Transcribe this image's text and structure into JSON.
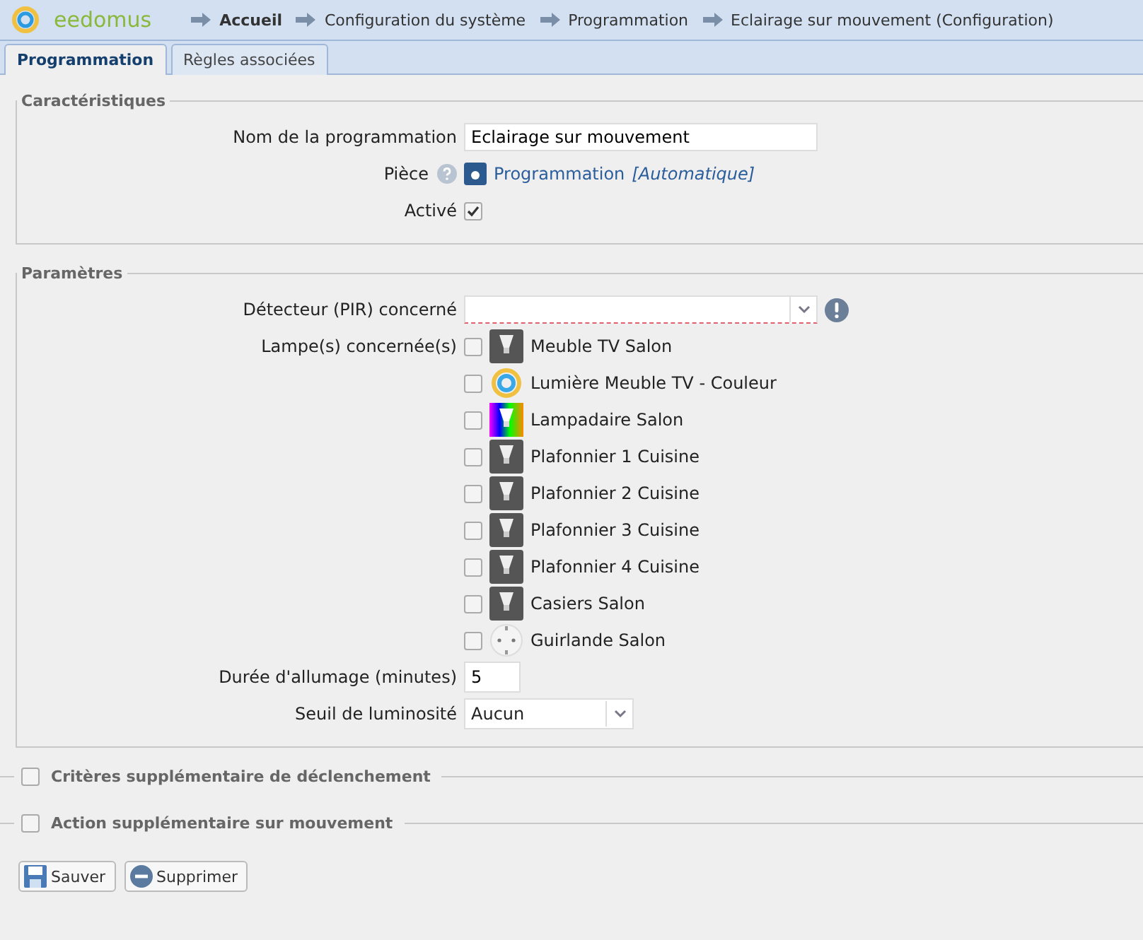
{
  "header": {
    "logo": "eedomus",
    "breadcrumbs": [
      "Accueil",
      "Configuration du système",
      "Programmation",
      "Eclairage sur mouvement (Configuration)"
    ]
  },
  "tabs": [
    {
      "label": "Programmation",
      "selected": true
    },
    {
      "label": "Règles associées",
      "selected": false
    }
  ],
  "caracteristiques": {
    "legend": "Caractéristiques",
    "name_label": "Nom de la programmation",
    "name_value": "Eclairage sur mouvement",
    "room_label": "Pièce",
    "room_value": "Programmation",
    "room_note": "[Automatique]",
    "active_label": "Activé",
    "active_checked": true
  },
  "parametres": {
    "legend": "Paramètres",
    "detector_label": "Détecteur (PIR) concerné",
    "lamps_label": "Lampe(s) concernée(s)",
    "lamps": [
      {
        "name": "Meuble TV Salon",
        "kind": "bulb",
        "checked": false
      },
      {
        "name": "Lumière Meuble TV - Couleur",
        "kind": "ring",
        "checked": false
      },
      {
        "name": "Lampadaire Salon",
        "kind": "color",
        "checked": false
      },
      {
        "name": "Plafonnier 1 Cuisine",
        "kind": "bulb",
        "checked": false
      },
      {
        "name": "Plafonnier 2 Cuisine",
        "kind": "bulb",
        "checked": false
      },
      {
        "name": "Plafonnier 3 Cuisine",
        "kind": "bulb",
        "checked": false
      },
      {
        "name": "Plafonnier 4 Cuisine",
        "kind": "bulb",
        "checked": false
      },
      {
        "name": "Casiers Salon",
        "kind": "bulb",
        "checked": false
      },
      {
        "name": "Guirlande Salon",
        "kind": "plug",
        "checked": false
      }
    ],
    "duration_label": "Durée d'allumage (minutes)",
    "duration_value": "5",
    "threshold_label": "Seuil de luminosité",
    "threshold_value": "Aucun"
  },
  "collapsed_sections": [
    {
      "legend": "Critères supplémentaire de déclenchement",
      "checked": false
    },
    {
      "legend": "Action supplémentaire sur mouvement",
      "checked": false
    }
  ],
  "buttons": [
    {
      "label": "Sauver",
      "kind": "save"
    },
    {
      "label": "Supprimer",
      "kind": "delete"
    }
  ]
}
